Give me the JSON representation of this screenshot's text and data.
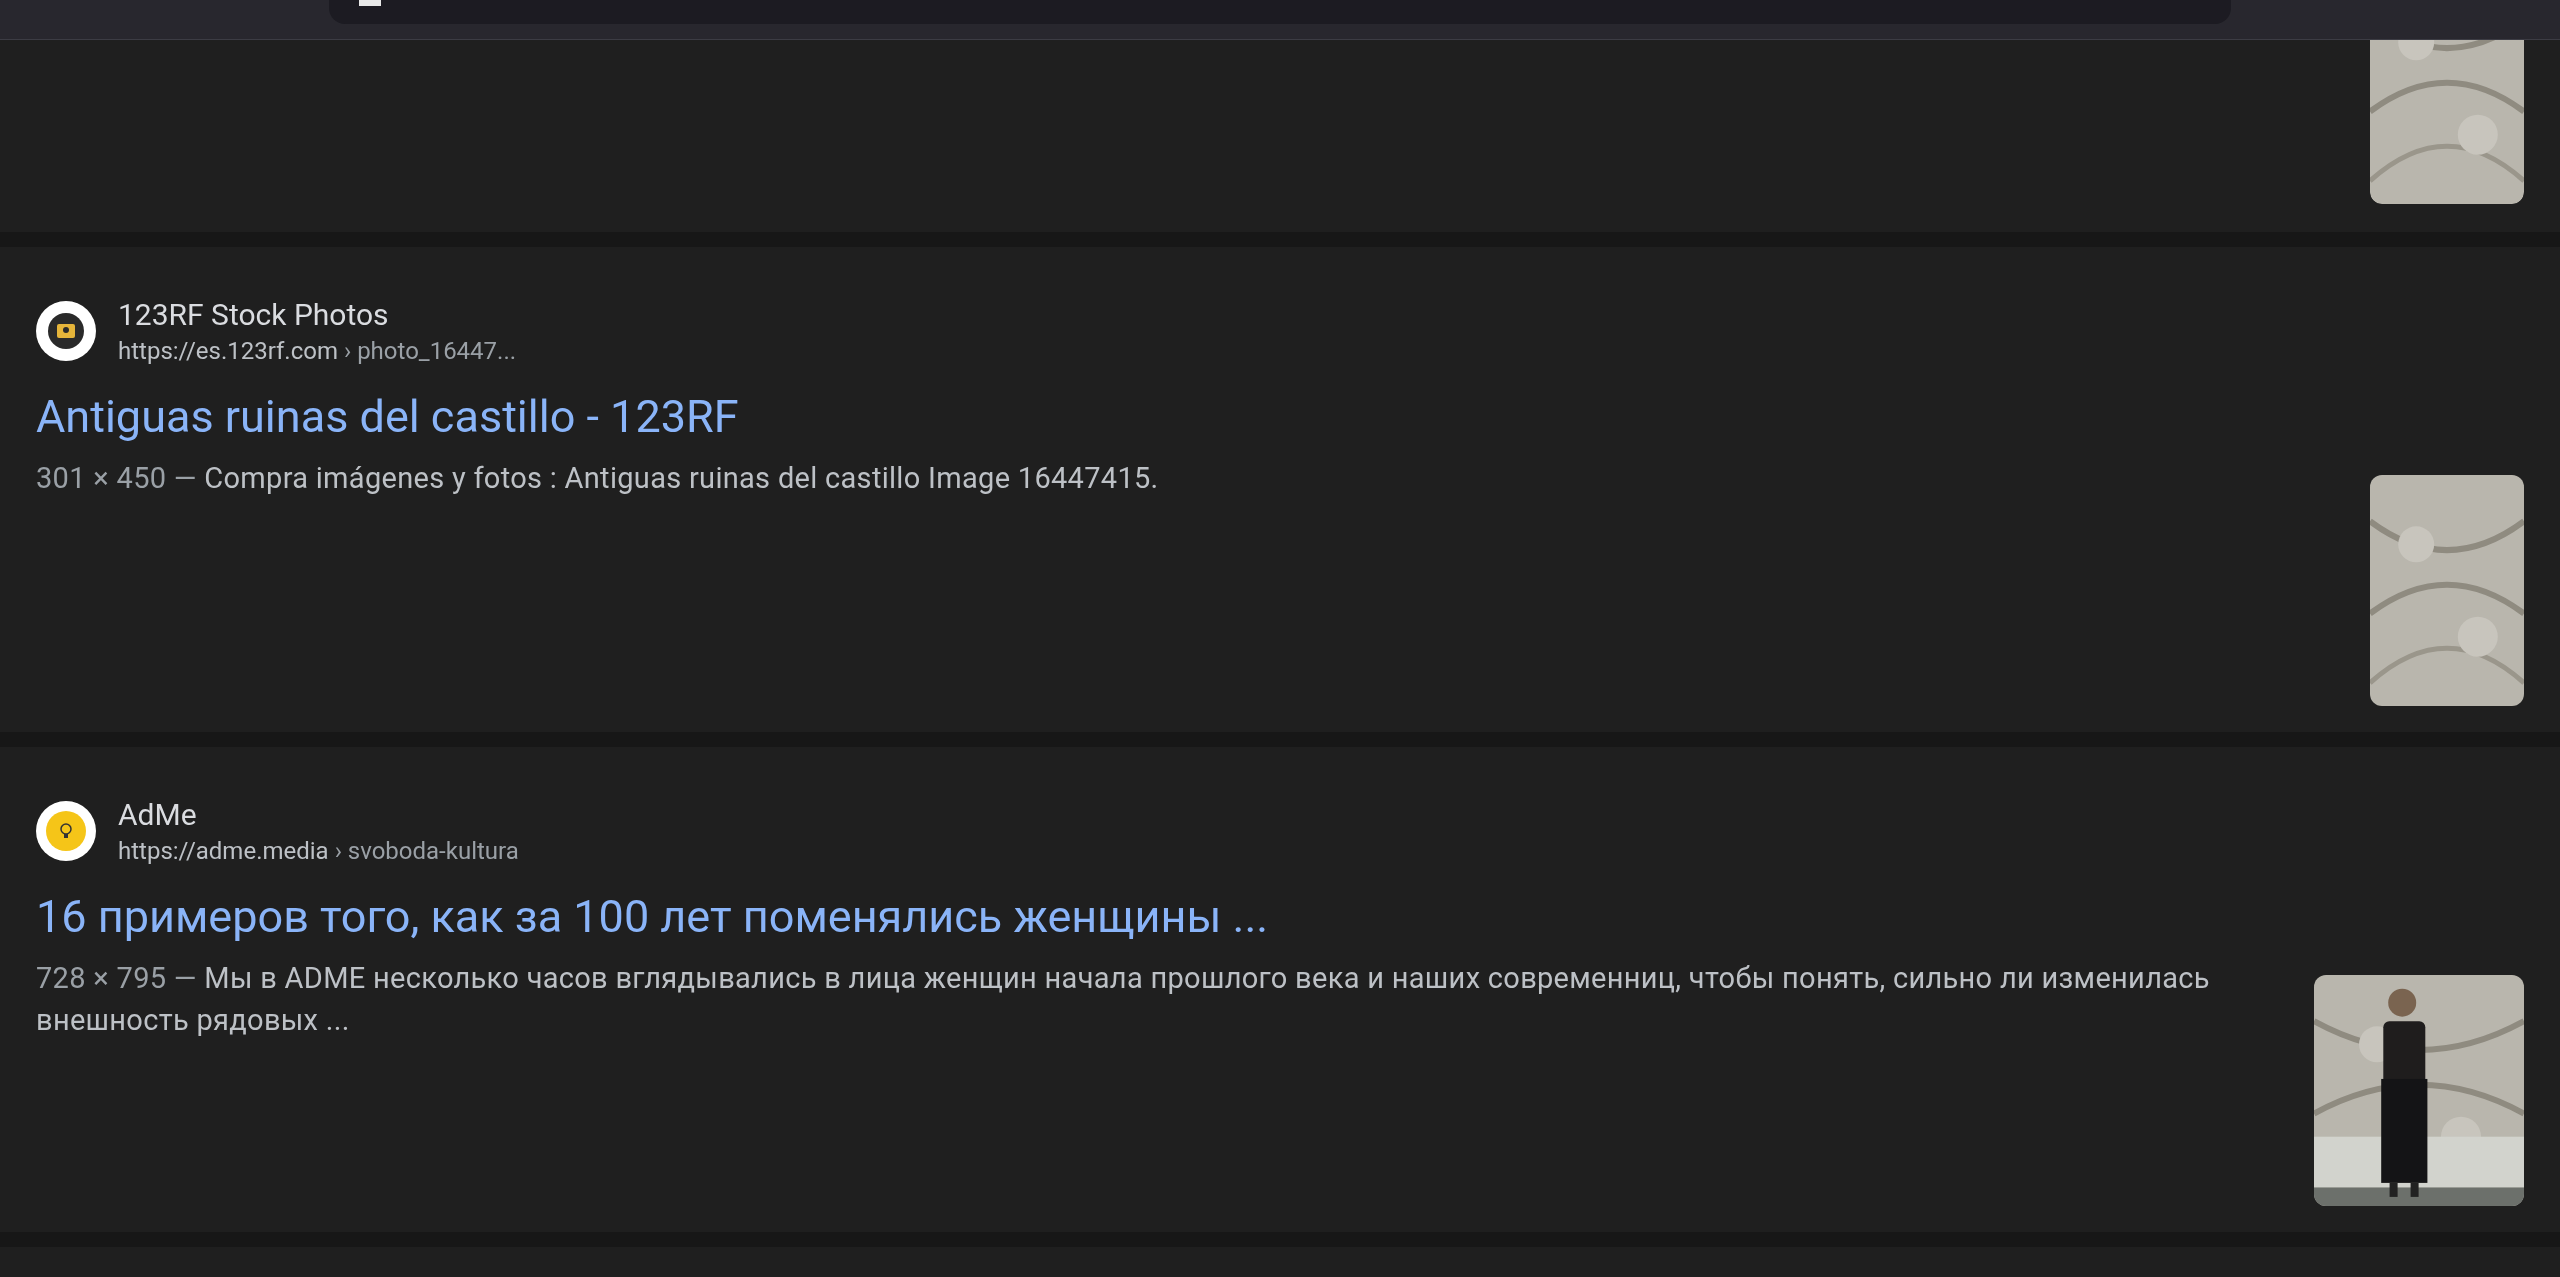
{
  "results": [
    {
      "kind": "thumbnail_only"
    },
    {
      "kind": "result",
      "site_name": "123RF Stock Photos",
      "url": "https://es.123rf.com",
      "breadcrumb": "› photo_16447...",
      "title": "Antiguas ruinas del castillo - 123RF",
      "dimensions": "301 × 450 —",
      "snippet": "Compra imágenes y fotos : Antiguas ruinas del castillo Image 16447415."
    },
    {
      "kind": "result",
      "site_name": "AdMe",
      "url": "https://adme.media",
      "breadcrumb": "› svoboda-kultura",
      "title": "16 примеров того, как за 100 лет поменялись женщины ...",
      "dimensions": "728 × 795 —",
      "snippet": "Мы в ADME несколько часов вглядывались в лица женщин начала прошлого века и наших современниц, чтобы понять, сильно ли изменилась внешность рядовых ..."
    }
  ]
}
